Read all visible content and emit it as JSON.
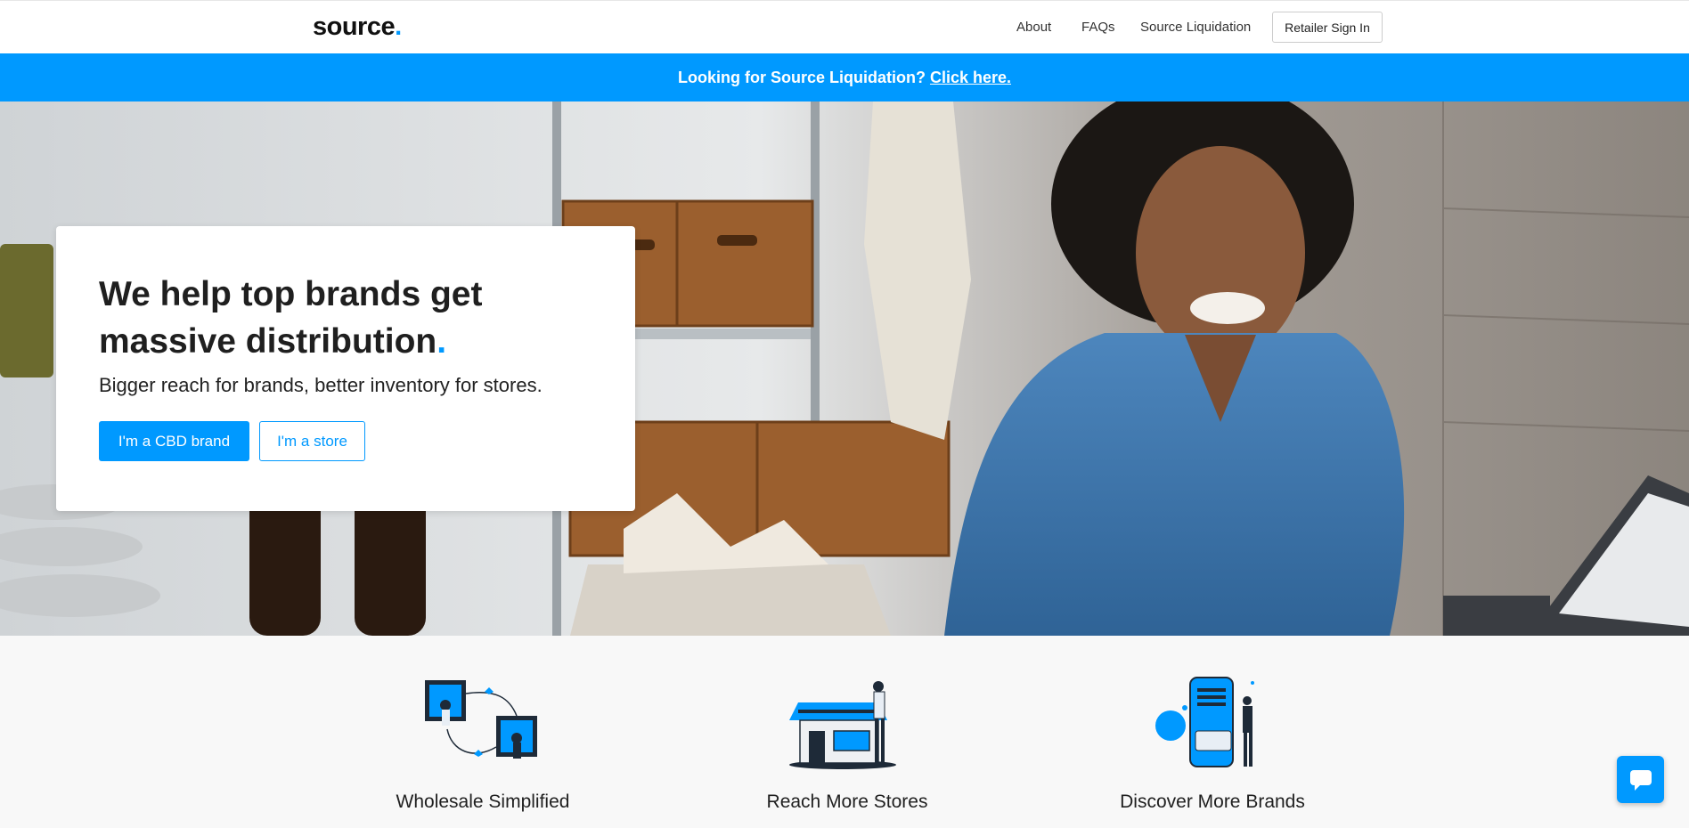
{
  "nav": {
    "logo_text": "source",
    "logo_dot": ".",
    "links": [
      "About",
      "FAQs",
      "Source Liquidation"
    ],
    "signin_label": "Retailer Sign In"
  },
  "announcement": {
    "text": "Looking for Source Liquidation?",
    "link_text": "Click here."
  },
  "hero": {
    "title": "We help top brands get massive distribution",
    "title_dot": ".",
    "subtitle": "Bigger reach for brands, better inventory for stores.",
    "primary_button": "I'm a CBD brand",
    "secondary_button": "I'm a store"
  },
  "features": [
    {
      "title": "Wholesale Simplified",
      "icon": "wholesale-illustration"
    },
    {
      "title": "Reach More Stores",
      "icon": "storefront-illustration"
    },
    {
      "title": "Discover More Brands",
      "icon": "phone-browse-illustration"
    }
  ],
  "colors": {
    "accent": "#0099ff",
    "text": "#1f1f1f"
  },
  "chat": {
    "icon": "chat-bubble-icon"
  }
}
